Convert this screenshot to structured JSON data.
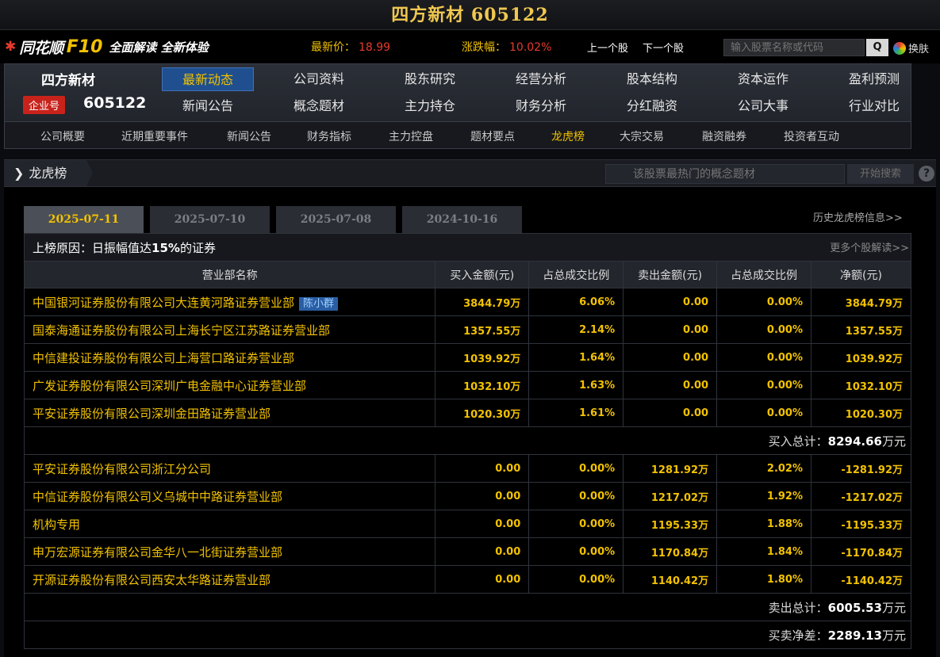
{
  "title": "四方新材 605122",
  "topbar": {
    "brand": "同花顺",
    "f10": "F10",
    "slogan": "全面解读 全新体验",
    "price_label": "最新价：",
    "price": "18.99",
    "change_label": "涨跌幅：",
    "change": "10.02%",
    "prev_stock": "上一个股",
    "next_stock": "下一个股",
    "search_placeholder": "输入股票名称或代码",
    "search_btn": "Q",
    "skin": "换肤"
  },
  "stock": {
    "name": "四方新材",
    "badge": "企业号",
    "code": "605122"
  },
  "menu_row1": [
    "最新动态",
    "公司资料",
    "股东研究",
    "经营分析",
    "股本结构",
    "资本运作",
    "盈利预测"
  ],
  "menu_row2": [
    "新闻公告",
    "概念题材",
    "主力持仓",
    "财务分析",
    "分红融资",
    "公司大事",
    "行业对比"
  ],
  "subnav": [
    "公司概要",
    "近期重要事件",
    "新闻公告",
    "财务指标",
    "主力控盘",
    "题材要点",
    "龙虎榜",
    "大宗交易",
    "融资融券",
    "投资者互动"
  ],
  "section": {
    "title": "龙虎榜",
    "concept_placeholder": "该股票最热门的概念题材",
    "start_btn": "开始搜索",
    "help": "?"
  },
  "tabs": [
    "2025-07-11",
    "2025-07-10",
    "2025-07-08",
    "2024-10-16"
  ],
  "history_link": "历史龙虎榜信息>>",
  "reason_label": "上榜原因：",
  "reason_prefix": "日振幅值达",
  "reason_bold": "15%",
  "reason_suffix": "的证券",
  "more_link": "更多个股解读>>",
  "columns": [
    "营业部名称",
    "买入金额(元)",
    "占总成交比例",
    "卖出金额(元)",
    "占总成交比例",
    "净额(元)"
  ],
  "buy_rows": [
    {
      "name": "中国银河证券股份有限公司大连黄河路证券营业部",
      "tag": "陈小群",
      "buy": "3844.79万",
      "buy_pct": "6.06%",
      "sell": "0.00",
      "sell_pct": "0.00%",
      "net": "3844.79万"
    },
    {
      "name": "国泰海通证券股份有限公司上海长宁区江苏路证券营业部",
      "tag": "",
      "buy": "1357.55万",
      "buy_pct": "2.14%",
      "sell": "0.00",
      "sell_pct": "0.00%",
      "net": "1357.55万"
    },
    {
      "name": "中信建投证券股份有限公司上海营口路证券营业部",
      "tag": "",
      "buy": "1039.92万",
      "buy_pct": "1.64%",
      "sell": "0.00",
      "sell_pct": "0.00%",
      "net": "1039.92万"
    },
    {
      "name": "广发证券股份有限公司深圳广电金融中心证券营业部",
      "tag": "",
      "buy": "1032.10万",
      "buy_pct": "1.63%",
      "sell": "0.00",
      "sell_pct": "0.00%",
      "net": "1032.10万"
    },
    {
      "name": "平安证券股份有限公司深圳金田路证券营业部",
      "tag": "",
      "buy": "1020.30万",
      "buy_pct": "1.61%",
      "sell": "0.00",
      "sell_pct": "0.00%",
      "net": "1020.30万"
    }
  ],
  "buy_total": {
    "label": "买入总计：",
    "value": "8294.66",
    "unit": "万元"
  },
  "sell_rows": [
    {
      "name": "平安证券股份有限公司浙江分公司",
      "tag": "",
      "buy": "0.00",
      "buy_pct": "0.00%",
      "sell": "1281.92万",
      "sell_pct": "2.02%",
      "net": "-1281.92万"
    },
    {
      "name": "中信证券股份有限公司义乌城中中路证券营业部",
      "tag": "",
      "buy": "0.00",
      "buy_pct": "0.00%",
      "sell": "1217.02万",
      "sell_pct": "1.92%",
      "net": "-1217.02万"
    },
    {
      "name": "机构专用",
      "tag": "",
      "buy": "0.00",
      "buy_pct": "0.00%",
      "sell": "1195.33万",
      "sell_pct": "1.88%",
      "net": "-1195.33万"
    },
    {
      "name": "申万宏源证券有限公司金华八一北街证券营业部",
      "tag": "",
      "buy": "0.00",
      "buy_pct": "0.00%",
      "sell": "1170.84万",
      "sell_pct": "1.84%",
      "net": "-1170.84万"
    },
    {
      "name": "开源证券股份有限公司西安太华路证券营业部",
      "tag": "",
      "buy": "0.00",
      "buy_pct": "0.00%",
      "sell": "1140.42万",
      "sell_pct": "1.80%",
      "net": "-1140.42万"
    }
  ],
  "sell_total": {
    "label": "卖出总计：",
    "value": "6005.53",
    "unit": "万元"
  },
  "net_total": {
    "label": "买卖净差：",
    "value": "2289.13",
    "unit": "万元"
  },
  "colors": {
    "accent": "#f2c200",
    "up": "#e53a2d",
    "active_tab": "#1f4f8e"
  }
}
